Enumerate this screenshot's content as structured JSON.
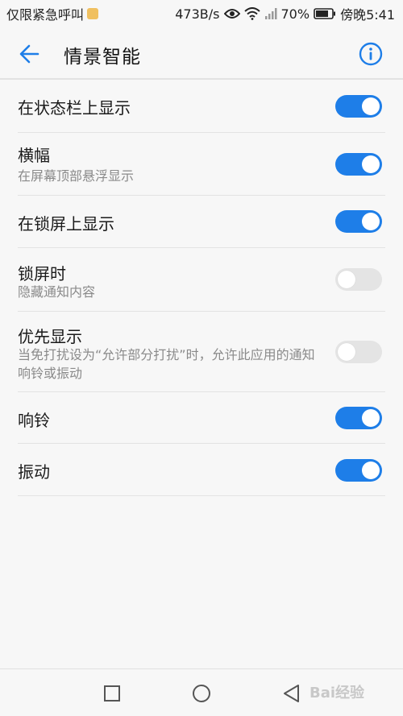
{
  "status_bar": {
    "carrier": "仅限紧急呼叫",
    "speed": "473B/s",
    "battery": "70%",
    "time": "傍晚5:41"
  },
  "app_bar": {
    "title": "情景智能"
  },
  "settings": [
    {
      "label": "在状态栏上显示",
      "subtitle": "",
      "enabled": true
    },
    {
      "label": "横幅",
      "subtitle": "在屏幕顶部悬浮显示",
      "enabled": true
    },
    {
      "label": "在锁屏上显示",
      "subtitle": "",
      "enabled": true
    },
    {
      "label": "锁屏时",
      "subtitle": "隐藏通知内容",
      "enabled": false
    },
    {
      "label": "优先显示",
      "subtitle": "当免打扰设为“允许部分打扰”时，允许此应用的通知响铃或振动",
      "enabled": false
    },
    {
      "label": "响铃",
      "subtitle": "",
      "enabled": true
    },
    {
      "label": "振动",
      "subtitle": "",
      "enabled": true
    }
  ],
  "watermark": "Bai经验",
  "colors": {
    "accent": "#1e7ee8",
    "switch_off": "#e4e4e4",
    "background": "#f7f7f7"
  }
}
